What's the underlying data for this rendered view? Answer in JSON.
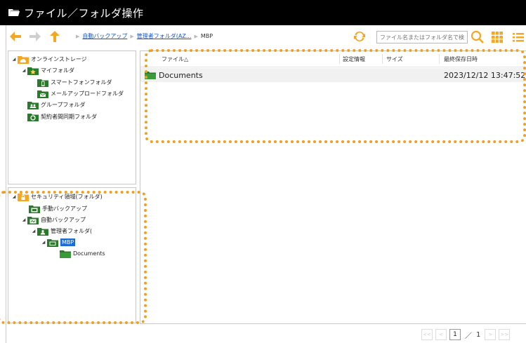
{
  "window": {
    "title": "ファイル／フォルダ操作"
  },
  "toolbar": {
    "breadcrumbs": [
      "自動バックアップ",
      "管理者フォルダ(AZ...",
      "MBP"
    ],
    "search_placeholder": "ファイル名またはフォルダ名で検索"
  },
  "tree_top": [
    {
      "label": "オンラインストレージ",
      "depth": 0,
      "expanded": true,
      "icon": "online-storage-icon"
    },
    {
      "label": "マイフォルダ",
      "depth": 1,
      "expanded": true,
      "icon": "my-folder-icon"
    },
    {
      "label": "スマートフォンフォルダ",
      "depth": 2,
      "expanded": false,
      "icon": "smartphone-folder-icon"
    },
    {
      "label": "メールアップロードフォルダ",
      "depth": 2,
      "expanded": false,
      "icon": "mail-folder-icon"
    },
    {
      "label": "グループフォルダ",
      "depth": 1,
      "expanded": false,
      "icon": "group-folder-icon"
    },
    {
      "label": "契約者間同期フォルダ",
      "depth": 1,
      "expanded": false,
      "icon": "sync-folder-icon"
    }
  ],
  "tree_bottom": [
    {
      "label": "セキュリティ領域(フォルダ)",
      "depth": 0,
      "expanded": true,
      "icon": "security-area-icon"
    },
    {
      "label": "手動バックアップ",
      "depth": 1,
      "expanded": false,
      "icon": "manual-backup-icon"
    },
    {
      "label": "自動バックアップ",
      "depth": 1,
      "expanded": true,
      "icon": "auto-backup-icon"
    },
    {
      "label": "管理者フォルダ(",
      "depth": 2,
      "expanded": true,
      "icon": "admin-folder-icon"
    },
    {
      "label": "MBP",
      "depth": 3,
      "expanded": true,
      "icon": "device-folder-icon",
      "selected": true
    },
    {
      "label": "Documents",
      "depth": 4,
      "expanded": false,
      "icon": "folder-icon"
    }
  ],
  "file_list": {
    "columns": [
      "ファイル△",
      "設定情報",
      "サイズ",
      "最終保存日時"
    ],
    "rows": [
      {
        "name": "Documents",
        "settings": "",
        "size": "",
        "modified": "2023/12/12 13:47:52"
      }
    ]
  },
  "pager": {
    "current": "1",
    "separator": "／",
    "total": "1"
  },
  "colors": {
    "accent": "#f5a623",
    "highlight": "#f0a020",
    "selection": "#1e6ad0",
    "link": "#1a56c8"
  }
}
